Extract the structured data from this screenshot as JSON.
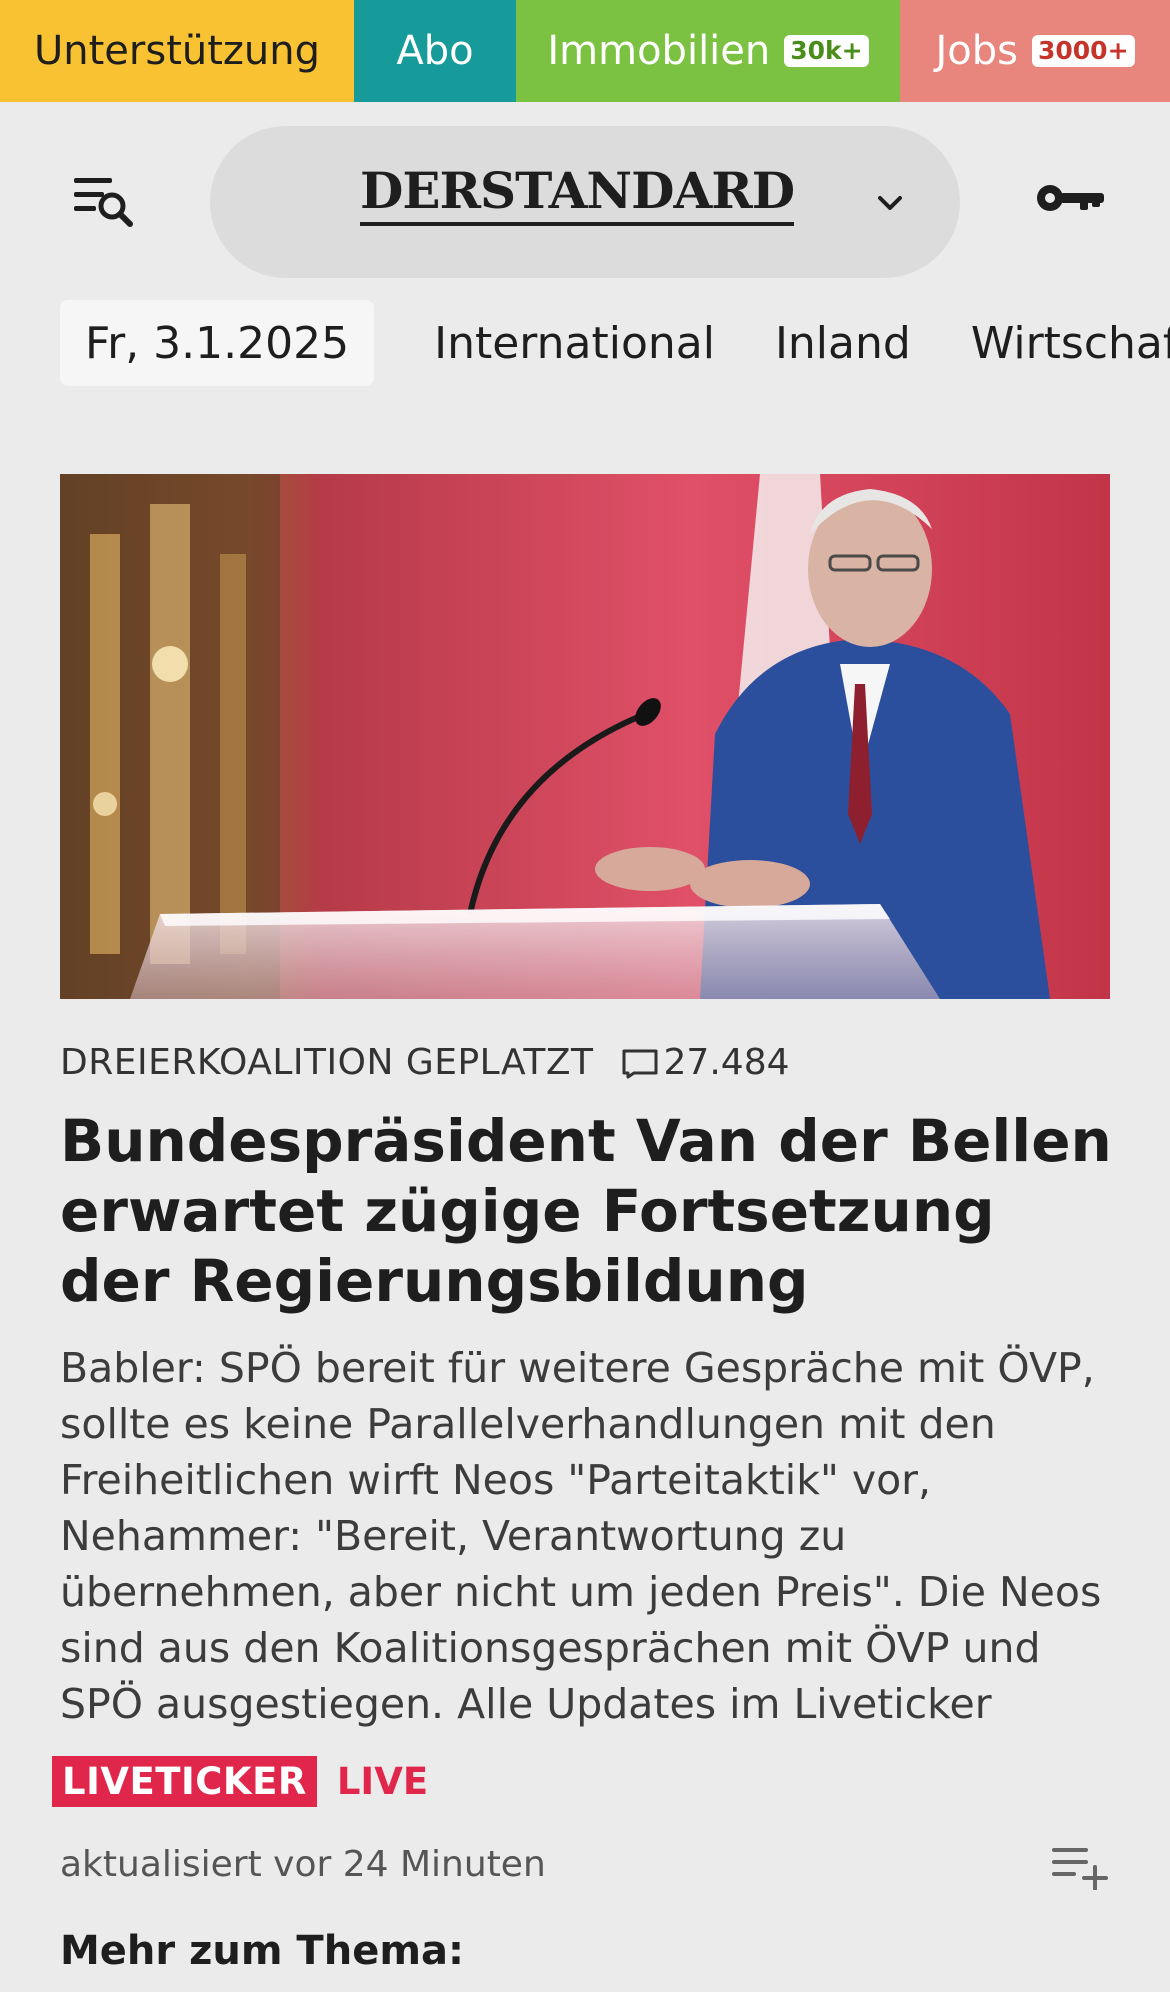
{
  "topnav": {
    "items": [
      {
        "label": "Unterstützung",
        "badge": null
      },
      {
        "label": "Abo",
        "badge": null
      },
      {
        "label": "Immobilien",
        "badge": "30k+"
      },
      {
        "label": "Jobs",
        "badge": "3000+"
      }
    ],
    "colors": {
      "unterstuetzung": "#f8c233",
      "abo": "#179a9a",
      "immobilien": "#7cc242",
      "jobs": "#e8857c"
    }
  },
  "header": {
    "logo": "DERSTANDARD",
    "menu_icon": "menu-search-icon",
    "chevron_icon": "chevron-down-icon",
    "key_icon": "key-icon"
  },
  "sections": {
    "date": "Fr, 3.1.2025",
    "items": [
      "International",
      "Inland",
      "Wirtschaft"
    ]
  },
  "article": {
    "kicker": "DREIERKOALITION GEPLATZT",
    "comment_count": "27.484",
    "headline": "Bundespräsident Van der Bellen erwartet zügige Fortsetzung der Regierungsbildung",
    "teaser": "Babler: SPÖ bereit für weitere Gespräche mit ÖVP, sollte es keine Parallelverhandlungen mit den Freiheitlichen wirft Neos \"Parteitaktik\" vor, Nehammer: \"Bereit, Verantwortung zu übernehmen, aber nicht um jeden Preis\". Die Neos sind aus den Koalitionsgesprächen mit ÖVP und SPÖ ausgestiegen. Alle Updates im Liveticker",
    "liveticker_label": "LIVETICKER",
    "live_label": "LIVE",
    "updated": "aktualisiert vor 24 Minuten",
    "more_topic": "Mehr zum Thema:",
    "accent_color": "#e0264b"
  }
}
